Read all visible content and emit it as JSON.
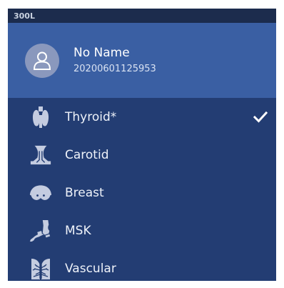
{
  "header": {
    "title": "300L"
  },
  "patient": {
    "name": "No Name",
    "id": "20200601125953"
  },
  "menu": {
    "items": [
      {
        "label": "Thyroid*",
        "icon": "thyroid-icon",
        "selected": true
      },
      {
        "label": "Carotid",
        "icon": "carotid-icon",
        "selected": false
      },
      {
        "label": "Breast",
        "icon": "breast-icon",
        "selected": false
      },
      {
        "label": "MSK",
        "icon": "msk-icon",
        "selected": false
      },
      {
        "label": "Vascular",
        "icon": "vascular-icon",
        "selected": false
      }
    ]
  },
  "colors": {
    "background": "#233d73",
    "header_bar": "#1c2c4d",
    "patient_panel": "#3a5fa3",
    "icon": "#c4cce0"
  }
}
